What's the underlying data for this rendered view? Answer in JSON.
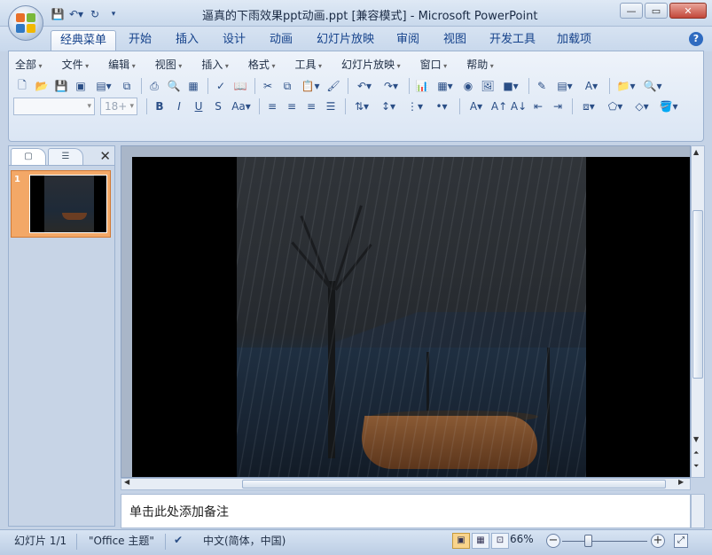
{
  "window": {
    "title": "逼真的下雨效果ppt动画.ppt [兼容模式] - Microsoft PowerPoint"
  },
  "tabs": [
    {
      "label": "经典菜单",
      "active": true
    },
    {
      "label": "开始"
    },
    {
      "label": "插入"
    },
    {
      "label": "设计"
    },
    {
      "label": "动画"
    },
    {
      "label": "幻灯片放映"
    },
    {
      "label": "审阅"
    },
    {
      "label": "视图"
    },
    {
      "label": "开发工具"
    },
    {
      "label": "加载项"
    }
  ],
  "menu": [
    "全部",
    "文件",
    "编辑",
    "视图",
    "插入",
    "格式",
    "工具",
    "幻灯片放映",
    "窗口",
    "帮助"
  ],
  "format": {
    "font_name": "",
    "font_size": "18+"
  },
  "slides_pane": {
    "slide_number": "1"
  },
  "notes": {
    "placeholder": "单击此处添加备注"
  },
  "status": {
    "slide_info": "幻灯片 1/1",
    "theme": "\"Office 主题\"",
    "language": "中文(简体，中国)",
    "zoom": "66%"
  },
  "colors": {
    "accent_selected_slide": "#f3a867",
    "ribbon_text": "#15428b"
  }
}
